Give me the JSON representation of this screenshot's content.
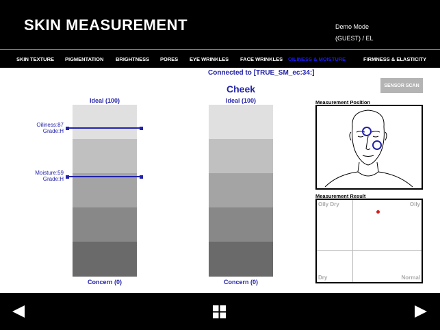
{
  "header": {
    "title": "SKIN MEASUREMENT",
    "mode": "Demo Mode",
    "user": "(GUEST) / EL"
  },
  "tabs": [
    {
      "label": "SKIN TEXTURE",
      "active": false
    },
    {
      "label": "PIGMENTATION",
      "active": false
    },
    {
      "label": "BRIGHTNESS",
      "active": false
    },
    {
      "label": "PORES",
      "active": false
    },
    {
      "label": "EYE WRINKLES",
      "active": false
    },
    {
      "label": "FACE WRINKLES",
      "active": false
    },
    {
      "label": "OILINESS & MOISTURE",
      "active": true
    },
    {
      "label": "FIRMNESS & ELASTICITY",
      "active": false
    }
  ],
  "status": {
    "connected": "Connected to [TRUE_SM_ec:34:]",
    "region": "Cheek"
  },
  "sensor_button": "SENSOR SCAN",
  "bars": {
    "left": {
      "top_label": "Ideal (100)",
      "bottom_label": "Concern (0)"
    },
    "right": {
      "top_label": "Ideal (100)",
      "bottom_label": "Concern (0)"
    }
  },
  "markers": {
    "oiliness": {
      "name": "Oiliness:87",
      "grade": "Grade:H",
      "value": 87
    },
    "moisture": {
      "name": "Moisture:59",
      "grade": "Grade:H",
      "value": 59
    }
  },
  "position_panel": {
    "title": "Measurement Position"
  },
  "result_panel": {
    "title": "Measurement Result",
    "quadrants": {
      "top_left": "Oily Dry",
      "top_right": "Oily",
      "bottom_left": "Dry",
      "bottom_right": "Normal"
    }
  },
  "colors": {
    "accent": "#2222aa",
    "active_tab": "#1a1aff",
    "result_point": "#d02020"
  }
}
